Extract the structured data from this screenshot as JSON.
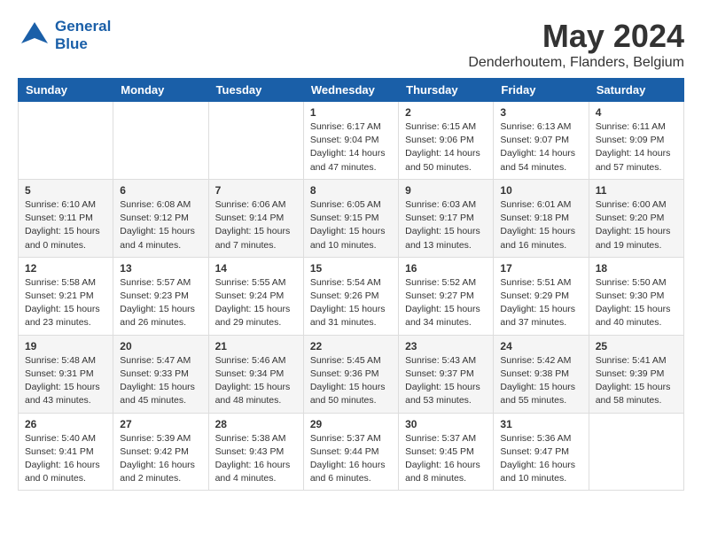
{
  "header": {
    "logo_line1": "General",
    "logo_line2": "Blue",
    "month_year": "May 2024",
    "location": "Denderhoutem, Flanders, Belgium"
  },
  "weekdays": [
    "Sunday",
    "Monday",
    "Tuesday",
    "Wednesday",
    "Thursday",
    "Friday",
    "Saturday"
  ],
  "weeks": [
    [
      {
        "num": "",
        "sunrise": "",
        "sunset": "",
        "daylight": ""
      },
      {
        "num": "",
        "sunrise": "",
        "sunset": "",
        "daylight": ""
      },
      {
        "num": "",
        "sunrise": "",
        "sunset": "",
        "daylight": ""
      },
      {
        "num": "1",
        "sunrise": "Sunrise: 6:17 AM",
        "sunset": "Sunset: 9:04 PM",
        "daylight": "Daylight: 14 hours and 47 minutes."
      },
      {
        "num": "2",
        "sunrise": "Sunrise: 6:15 AM",
        "sunset": "Sunset: 9:06 PM",
        "daylight": "Daylight: 14 hours and 50 minutes."
      },
      {
        "num": "3",
        "sunrise": "Sunrise: 6:13 AM",
        "sunset": "Sunset: 9:07 PM",
        "daylight": "Daylight: 14 hours and 54 minutes."
      },
      {
        "num": "4",
        "sunrise": "Sunrise: 6:11 AM",
        "sunset": "Sunset: 9:09 PM",
        "daylight": "Daylight: 14 hours and 57 minutes."
      }
    ],
    [
      {
        "num": "5",
        "sunrise": "Sunrise: 6:10 AM",
        "sunset": "Sunset: 9:11 PM",
        "daylight": "Daylight: 15 hours and 0 minutes."
      },
      {
        "num": "6",
        "sunrise": "Sunrise: 6:08 AM",
        "sunset": "Sunset: 9:12 PM",
        "daylight": "Daylight: 15 hours and 4 minutes."
      },
      {
        "num": "7",
        "sunrise": "Sunrise: 6:06 AM",
        "sunset": "Sunset: 9:14 PM",
        "daylight": "Daylight: 15 hours and 7 minutes."
      },
      {
        "num": "8",
        "sunrise": "Sunrise: 6:05 AM",
        "sunset": "Sunset: 9:15 PM",
        "daylight": "Daylight: 15 hours and 10 minutes."
      },
      {
        "num": "9",
        "sunrise": "Sunrise: 6:03 AM",
        "sunset": "Sunset: 9:17 PM",
        "daylight": "Daylight: 15 hours and 13 minutes."
      },
      {
        "num": "10",
        "sunrise": "Sunrise: 6:01 AM",
        "sunset": "Sunset: 9:18 PM",
        "daylight": "Daylight: 15 hours and 16 minutes."
      },
      {
        "num": "11",
        "sunrise": "Sunrise: 6:00 AM",
        "sunset": "Sunset: 9:20 PM",
        "daylight": "Daylight: 15 hours and 19 minutes."
      }
    ],
    [
      {
        "num": "12",
        "sunrise": "Sunrise: 5:58 AM",
        "sunset": "Sunset: 9:21 PM",
        "daylight": "Daylight: 15 hours and 23 minutes."
      },
      {
        "num": "13",
        "sunrise": "Sunrise: 5:57 AM",
        "sunset": "Sunset: 9:23 PM",
        "daylight": "Daylight: 15 hours and 26 minutes."
      },
      {
        "num": "14",
        "sunrise": "Sunrise: 5:55 AM",
        "sunset": "Sunset: 9:24 PM",
        "daylight": "Daylight: 15 hours and 29 minutes."
      },
      {
        "num": "15",
        "sunrise": "Sunrise: 5:54 AM",
        "sunset": "Sunset: 9:26 PM",
        "daylight": "Daylight: 15 hours and 31 minutes."
      },
      {
        "num": "16",
        "sunrise": "Sunrise: 5:52 AM",
        "sunset": "Sunset: 9:27 PM",
        "daylight": "Daylight: 15 hours and 34 minutes."
      },
      {
        "num": "17",
        "sunrise": "Sunrise: 5:51 AM",
        "sunset": "Sunset: 9:29 PM",
        "daylight": "Daylight: 15 hours and 37 minutes."
      },
      {
        "num": "18",
        "sunrise": "Sunrise: 5:50 AM",
        "sunset": "Sunset: 9:30 PM",
        "daylight": "Daylight: 15 hours and 40 minutes."
      }
    ],
    [
      {
        "num": "19",
        "sunrise": "Sunrise: 5:48 AM",
        "sunset": "Sunset: 9:31 PM",
        "daylight": "Daylight: 15 hours and 43 minutes."
      },
      {
        "num": "20",
        "sunrise": "Sunrise: 5:47 AM",
        "sunset": "Sunset: 9:33 PM",
        "daylight": "Daylight: 15 hours and 45 minutes."
      },
      {
        "num": "21",
        "sunrise": "Sunrise: 5:46 AM",
        "sunset": "Sunset: 9:34 PM",
        "daylight": "Daylight: 15 hours and 48 minutes."
      },
      {
        "num": "22",
        "sunrise": "Sunrise: 5:45 AM",
        "sunset": "Sunset: 9:36 PM",
        "daylight": "Daylight: 15 hours and 50 minutes."
      },
      {
        "num": "23",
        "sunrise": "Sunrise: 5:43 AM",
        "sunset": "Sunset: 9:37 PM",
        "daylight": "Daylight: 15 hours and 53 minutes."
      },
      {
        "num": "24",
        "sunrise": "Sunrise: 5:42 AM",
        "sunset": "Sunset: 9:38 PM",
        "daylight": "Daylight: 15 hours and 55 minutes."
      },
      {
        "num": "25",
        "sunrise": "Sunrise: 5:41 AM",
        "sunset": "Sunset: 9:39 PM",
        "daylight": "Daylight: 15 hours and 58 minutes."
      }
    ],
    [
      {
        "num": "26",
        "sunrise": "Sunrise: 5:40 AM",
        "sunset": "Sunset: 9:41 PM",
        "daylight": "Daylight: 16 hours and 0 minutes."
      },
      {
        "num": "27",
        "sunrise": "Sunrise: 5:39 AM",
        "sunset": "Sunset: 9:42 PM",
        "daylight": "Daylight: 16 hours and 2 minutes."
      },
      {
        "num": "28",
        "sunrise": "Sunrise: 5:38 AM",
        "sunset": "Sunset: 9:43 PM",
        "daylight": "Daylight: 16 hours and 4 minutes."
      },
      {
        "num": "29",
        "sunrise": "Sunrise: 5:37 AM",
        "sunset": "Sunset: 9:44 PM",
        "daylight": "Daylight: 16 hours and 6 minutes."
      },
      {
        "num": "30",
        "sunrise": "Sunrise: 5:37 AM",
        "sunset": "Sunset: 9:45 PM",
        "daylight": "Daylight: 16 hours and 8 minutes."
      },
      {
        "num": "31",
        "sunrise": "Sunrise: 5:36 AM",
        "sunset": "Sunset: 9:47 PM",
        "daylight": "Daylight: 16 hours and 10 minutes."
      },
      {
        "num": "",
        "sunrise": "",
        "sunset": "",
        "daylight": ""
      }
    ]
  ]
}
